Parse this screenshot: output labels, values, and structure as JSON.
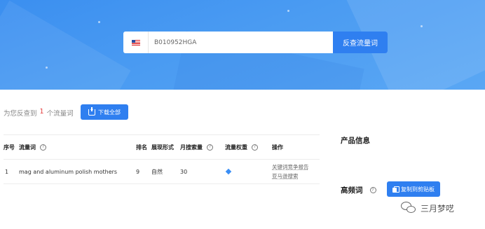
{
  "search": {
    "marketplace_flag": "us-flag-icon",
    "value": "B010952HGA",
    "button_label": "反查流量词"
  },
  "summary": {
    "prefix": "为您反查到",
    "count": "1",
    "suffix": "个流量词",
    "download_label": "下载全部"
  },
  "table": {
    "headers": {
      "index": "序号",
      "keyword": "流量词",
      "rank": "排名",
      "form": "展现形式",
      "volume": "月搜索量",
      "weight": "流量权重",
      "operation": "操作"
    },
    "rows": [
      {
        "index": "1",
        "keyword": "mag and aluminum polish mothers",
        "rank": "9",
        "form": "自然",
        "volume": "30",
        "weight_icon": "diamond-icon",
        "op1": "关键词竞争报告",
        "op2": "亚马逊搜索"
      }
    ]
  },
  "right": {
    "product_info_title": "产品信息",
    "high_freq_title": "高频词",
    "copy_label": "复制到剪贴板"
  },
  "watermark": {
    "text": "三月梦呓"
  },
  "colors": {
    "primary": "#2f7ff0",
    "hero": "#4a9bf2",
    "highlight": "#e43c3c"
  }
}
